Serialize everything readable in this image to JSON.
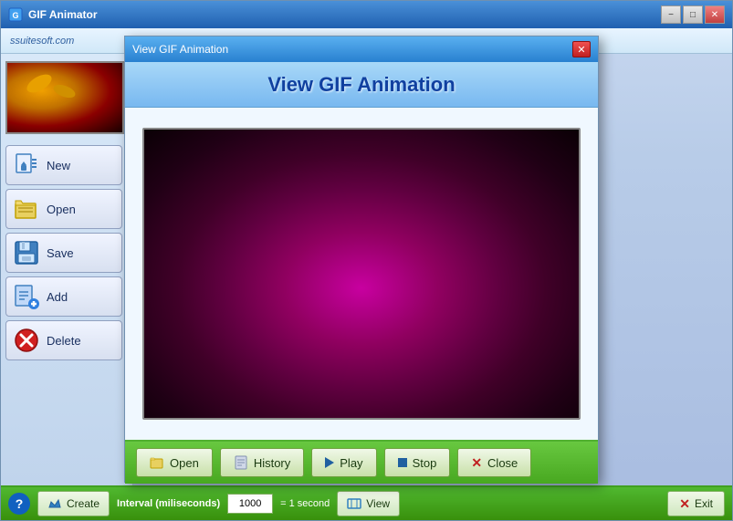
{
  "app": {
    "title": "GIF Animator",
    "brand": "ssuitesoft.com"
  },
  "titlebar": {
    "minimize_label": "−",
    "maximize_label": "□",
    "close_label": "✕"
  },
  "sidebar": {
    "buttons": [
      {
        "id": "new",
        "label": "New",
        "icon": "new-icon"
      },
      {
        "id": "open",
        "label": "Open",
        "icon": "open-icon"
      },
      {
        "id": "save",
        "label": "Save",
        "icon": "save-icon"
      },
      {
        "id": "add",
        "label": "Add",
        "icon": "add-icon"
      },
      {
        "id": "delete",
        "label": "Delete",
        "icon": "delete-icon"
      }
    ]
  },
  "statusbar": {
    "help_label": "?",
    "create_label": "Create",
    "interval_label": "Interval (miliseconds)",
    "interval_value": "1000",
    "interval_equal": "= 1 second",
    "view_label": "View",
    "exit_label": "Exit"
  },
  "dialog": {
    "title": "View GIF Animation",
    "header_title": "View GIF Animation",
    "footer_buttons": [
      {
        "id": "open",
        "label": "Open"
      },
      {
        "id": "history",
        "label": "History"
      },
      {
        "id": "play",
        "label": "Play"
      },
      {
        "id": "stop",
        "label": "Stop"
      },
      {
        "id": "close",
        "label": "Close"
      }
    ]
  }
}
